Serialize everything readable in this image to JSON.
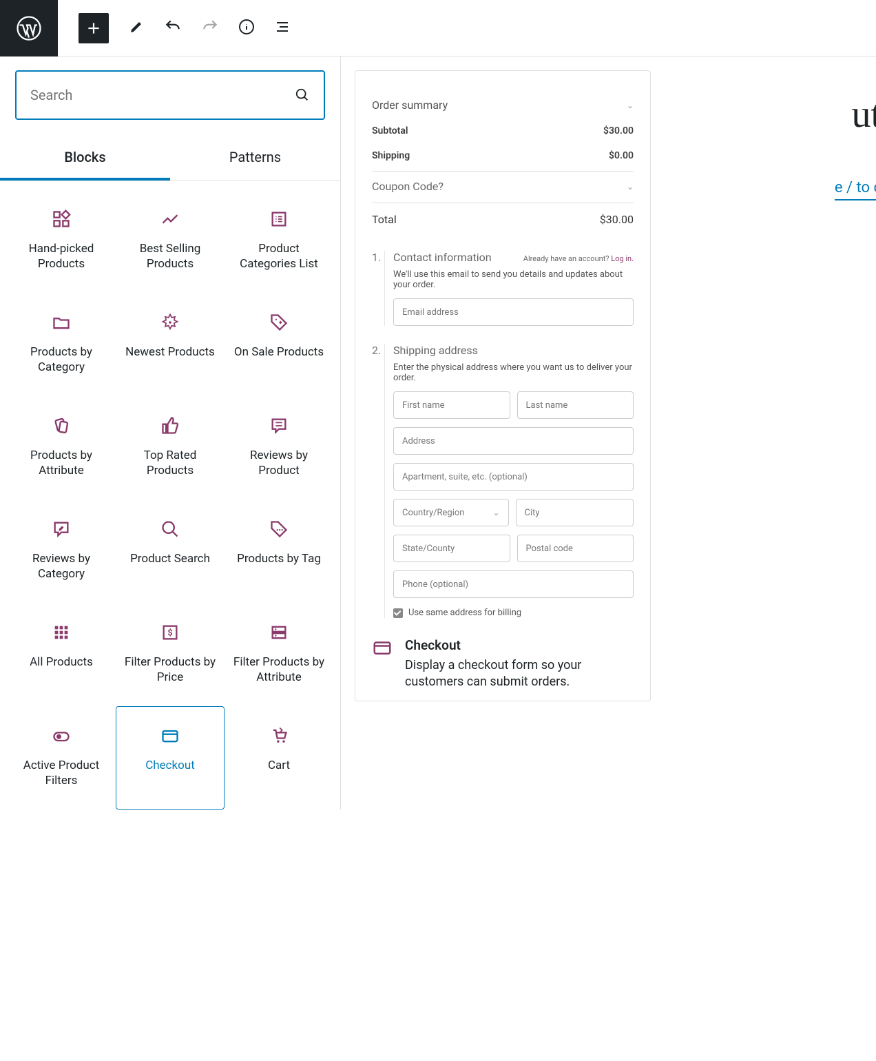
{
  "topbar": {
    "search_placeholder": "Search"
  },
  "tabs": {
    "blocks": "Blocks",
    "patterns": "Patterns"
  },
  "blocks": [
    {
      "label": "Hand-picked Products"
    },
    {
      "label": "Best Selling Products"
    },
    {
      "label": "Product Categories List"
    },
    {
      "label": "Products by Category"
    },
    {
      "label": "Newest Products"
    },
    {
      "label": "On Sale Products"
    },
    {
      "label": "Products by Attribute"
    },
    {
      "label": "Top Rated Products"
    },
    {
      "label": "Reviews by Product"
    },
    {
      "label": "Reviews by Category"
    },
    {
      "label": "Product Search"
    },
    {
      "label": "Products by Tag"
    },
    {
      "label": "All Products"
    },
    {
      "label": "Filter Products by Price"
    },
    {
      "label": "Filter Products by Attribute"
    },
    {
      "label": "Active Product Filters"
    },
    {
      "label": "Checkout"
    },
    {
      "label": "Cart"
    }
  ],
  "summary": {
    "title": "Order summary",
    "subtotal_label": "Subtotal",
    "subtotal": "$30.00",
    "shipping_label": "Shipping",
    "shipping": "$0.00",
    "coupon": "Coupon Code?",
    "total_label": "Total",
    "total": "$30.00"
  },
  "contact": {
    "num": "1.",
    "title": "Contact information",
    "login_prefix": "Already have an account? ",
    "login": "Log in.",
    "desc": "We'll use this email to send you details and updates about your order.",
    "email": "Email address"
  },
  "shipping_addr": {
    "num": "2.",
    "title": "Shipping address",
    "desc": "Enter the physical address where you want us to deliver your order.",
    "first": "First name",
    "last": "Last name",
    "address": "Address",
    "apt": "Apartment, suite, etc. (optional)",
    "country": "Country/Region",
    "city": "City",
    "state": "State/County",
    "postal": "Postal code",
    "phone": "Phone (optional)",
    "same_billing": "Use same address for billing"
  },
  "info": {
    "title": "Checkout",
    "desc": "Display a checkout form so your customers can submit orders."
  },
  "bg": {
    "t1": "ut",
    "t2": "e / to c"
  }
}
